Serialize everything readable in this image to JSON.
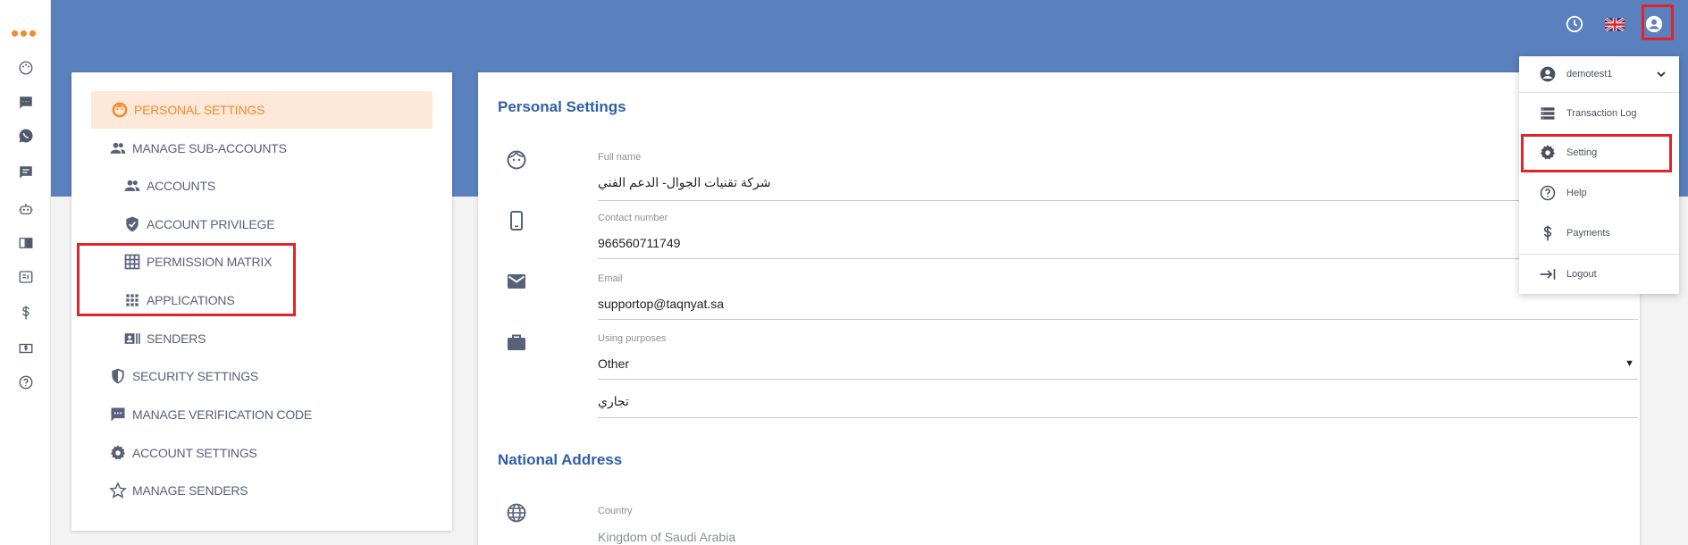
{
  "rail": {
    "icons": [
      "logo-dots-icon",
      "palette-icon",
      "sms-icon",
      "whatsapp-icon",
      "chat-icon",
      "bot-icon",
      "book-icon",
      "report-icon",
      "dollar-icon",
      "invoice-icon",
      "help-icon"
    ]
  },
  "header": {
    "icons": [
      "history-icon",
      "uk-flag-icon",
      "account-circle-icon"
    ]
  },
  "settings_menu": {
    "items": [
      {
        "label": "PERSONAL SETTINGS",
        "icon": "face-icon"
      },
      {
        "label": "MANAGE SUB-ACCOUNTS",
        "icon": "people-icon"
      },
      {
        "label": "ACCOUNTS",
        "icon": "people-icon"
      },
      {
        "label": "ACCOUNT PRIVILEGE",
        "icon": "verified-shield-icon"
      },
      {
        "label": "PERMISSION MATRIX",
        "icon": "grid-icon"
      },
      {
        "label": "APPLICATIONS",
        "icon": "apps-icon"
      },
      {
        "label": "SENDERS",
        "icon": "contact-card-icon"
      },
      {
        "label": "SECURITY SETTINGS",
        "icon": "security-shield-icon"
      },
      {
        "label": "MANAGE VERIFICATION CODE",
        "icon": "sms-dots-icon"
      },
      {
        "label": "ACCOUNT SETTINGS",
        "icon": "gear-icon"
      },
      {
        "label": "MANAGE SENDERS",
        "icon": "star-icon"
      }
    ]
  },
  "main": {
    "personal_title": "Personal Settings",
    "full_name": {
      "label": "Full name",
      "value": "شركة تقنيات الجوال- الدعم الفني"
    },
    "contact_number": {
      "label": "Contact number",
      "value": "966560711749"
    },
    "email": {
      "label": "Email",
      "value": "supportop@taqnyat.sa"
    },
    "using_purposes": {
      "label": "Using purposes",
      "value": "Other",
      "extra_value": "تجاري"
    },
    "national_title": "National Address",
    "country": {
      "label": "Country",
      "value": "Kingdom of Saudi Arabia"
    }
  },
  "user_menu": {
    "username": "demotest1",
    "items": [
      {
        "label": "Transaction Log",
        "icon": "list-icon"
      },
      {
        "label": "Setting",
        "icon": "gear-icon"
      },
      {
        "label": "Help",
        "icon": "help-icon"
      },
      {
        "label": "Payments",
        "icon": "dollar-icon"
      },
      {
        "label": "Logout",
        "icon": "logout-arrow-icon"
      }
    ]
  },
  "colors": {
    "header_blue": "#5a80bd",
    "accent_orange": "#f08a2c",
    "active_bg": "#fde8da",
    "title_blue": "#2f5fa6",
    "highlight_red": "#e0242a"
  }
}
